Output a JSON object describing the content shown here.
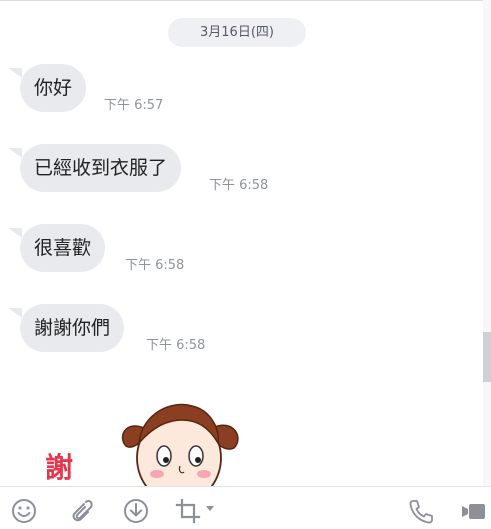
{
  "chat": {
    "date_label": "3月16日(四)",
    "messages": [
      {
        "text": "你好",
        "time": "下午 6:57"
      },
      {
        "text": "已經收到衣服了",
        "time": "下午 6:58"
      },
      {
        "text": "很喜歡",
        "time": "下午 6:58"
      },
      {
        "text": "謝謝你們",
        "time": "下午 6:58"
      }
    ],
    "sticker": {
      "text": "謝"
    }
  },
  "toolbar": {
    "icons": [
      "emoji-icon",
      "attach-icon",
      "download-icon",
      "crop-icon",
      "phone-icon",
      "video-call-icon"
    ]
  },
  "colors": {
    "bubble": "#e8eaee",
    "time": "#8f949c",
    "sticker_red": "#e6364d",
    "icon": "#8b9099"
  }
}
